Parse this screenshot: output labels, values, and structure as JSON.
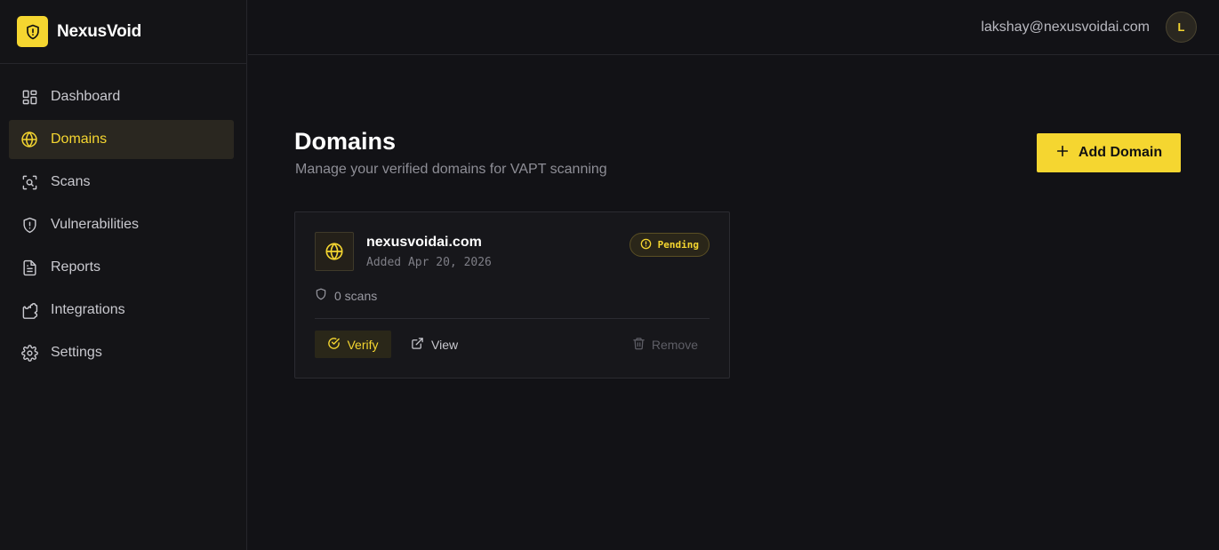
{
  "brand": {
    "name": "NexusVoid",
    "logo_icon": "shield-alert-icon",
    "accent_color": "#f5d630"
  },
  "sidebar": {
    "items": [
      {
        "label": "Dashboard",
        "icon": "dashboard-icon",
        "active": false
      },
      {
        "label": "Domains",
        "icon": "globe-icon",
        "active": true
      },
      {
        "label": "Scans",
        "icon": "scan-icon",
        "active": false
      },
      {
        "label": "Vulnerabilities",
        "icon": "shield-alert-icon",
        "active": false
      },
      {
        "label": "Reports",
        "icon": "report-icon",
        "active": false
      },
      {
        "label": "Integrations",
        "icon": "puzzle-icon",
        "active": false
      },
      {
        "label": "Settings",
        "icon": "gear-icon",
        "active": false
      }
    ]
  },
  "header": {
    "user_email": "lakshay@nexusvoidai.com",
    "avatar_initial": "L"
  },
  "main": {
    "title": "Domains",
    "subtitle": "Manage your verified domains for VAPT scanning",
    "add_button_label": "Add Domain",
    "domains": [
      {
        "name": "nexusvoidai.com",
        "added": "Added Apr 20, 2026",
        "status": "Pending",
        "scans": "0 scans",
        "actions": {
          "verify": "Verify",
          "view": "View",
          "remove": "Remove"
        }
      }
    ]
  }
}
